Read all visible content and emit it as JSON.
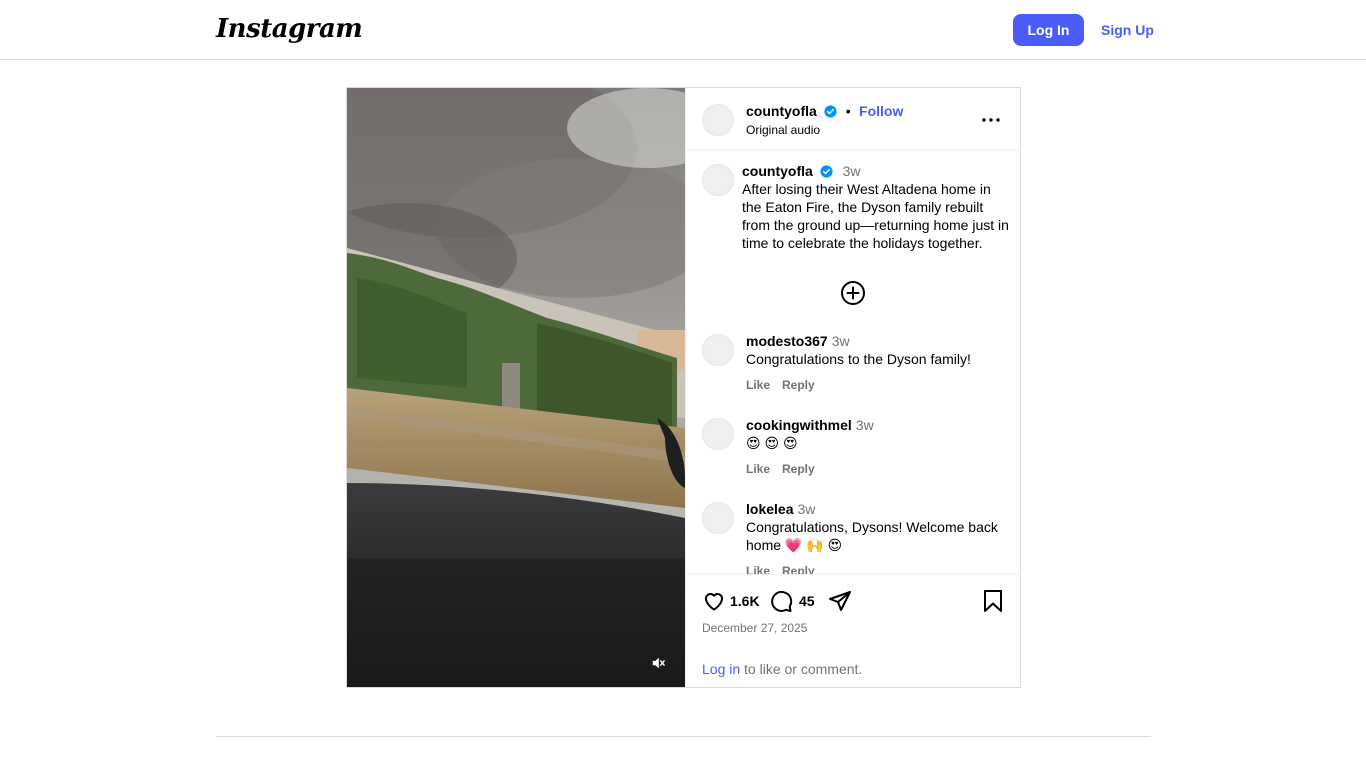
{
  "nav": {
    "logo": "Instagram",
    "login_label": "Log In",
    "signup_label": "Sign Up"
  },
  "post": {
    "header": {
      "username": "countyofla",
      "follow_label": "Follow",
      "audio": "Original audio"
    },
    "caption": {
      "username": "countyofla",
      "time": "3w",
      "text": "After losing their West Altadena home in the Eaton Fire, the Dyson family rebuilt from the ground up—returning home just in time to celebrate the holidays together."
    },
    "comments": [
      {
        "username": "modesto367",
        "time": "3w",
        "text": "Congratulations to the Dyson family!",
        "like_label": "Like",
        "reply_label": "Reply"
      },
      {
        "username": "cookingwithmel",
        "time": "3w",
        "text": "😍 😍 😍",
        "like_label": "Like",
        "reply_label": "Reply"
      },
      {
        "username": "lokelea",
        "time": "3w",
        "text": "Congratulations, Dysons! Welcome back home 💗 🙌 😍",
        "like_label": "Like",
        "reply_label": "Reply"
      }
    ],
    "likes_count": "1.6K",
    "comments_count": "45",
    "date": "December 27, 2025",
    "login_prompt": {
      "link": "Log in",
      "rest": " to like or comment."
    }
  },
  "colors": {
    "accent": "#4a5df9",
    "verified": "#0095f6",
    "muted": "#737373",
    "border": "#dbdbdb"
  },
  "icons": [
    "verified-badge-icon",
    "more-options-icon",
    "add-comment-icon",
    "heart-icon",
    "comment-icon",
    "share-icon",
    "bookmark-icon",
    "mute-icon"
  ]
}
